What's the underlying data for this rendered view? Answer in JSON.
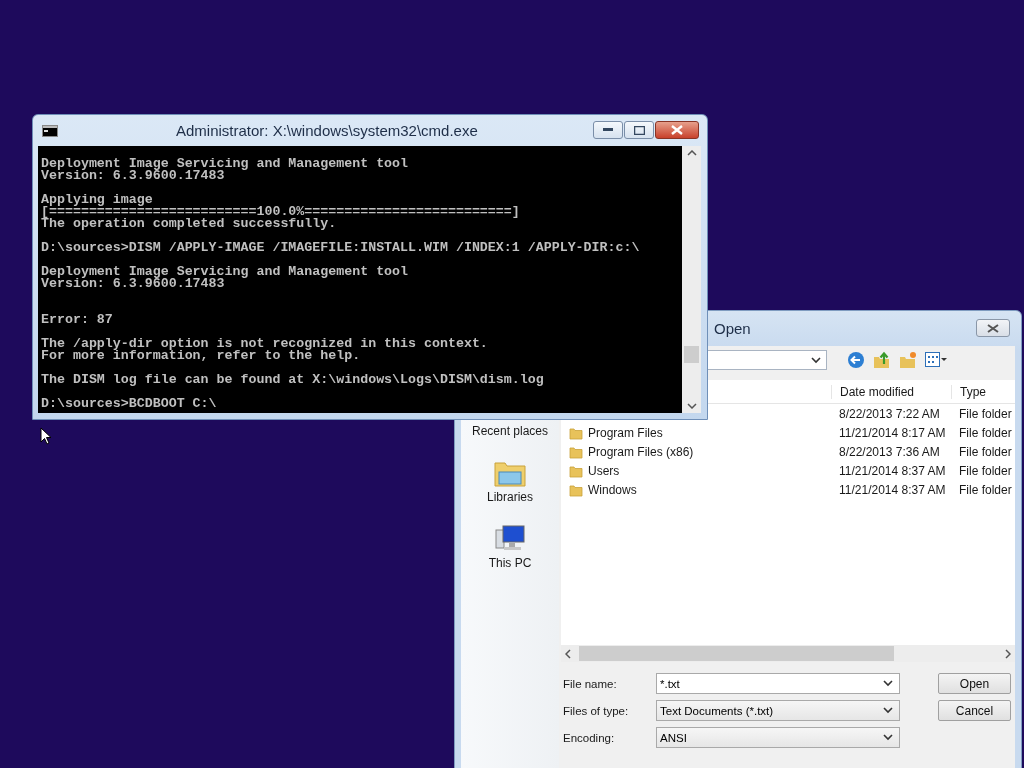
{
  "cmd_window": {
    "title": "Administrator: X:\\windows\\system32\\cmd.exe",
    "lines": [
      {
        "kind": "text",
        "text": "Deployment Image Servicing and Management tool"
      },
      {
        "kind": "text",
        "text": "Version: 6.3.9600.17483"
      },
      {
        "kind": "blank"
      },
      {
        "kind": "text",
        "text": "Applying image"
      },
      {
        "kind": "text",
        "text": "[==========================100.0%==========================]"
      },
      {
        "kind": "text",
        "text": "The operation completed successfully."
      },
      {
        "kind": "blank"
      },
      {
        "kind": "text",
        "text": "D:\\sources>DISM /APPLY-IMAGE /IMAGEFILE:INSTALL.WIM /INDEX:1 /APPLY-DIR:c:\\"
      },
      {
        "kind": "blank"
      },
      {
        "kind": "text",
        "text": "Deployment Image Servicing and Management tool"
      },
      {
        "kind": "text",
        "text": "Version: 6.3.9600.17483"
      },
      {
        "kind": "blank"
      },
      {
        "kind": "blank"
      },
      {
        "kind": "text",
        "text": "Error: 87"
      },
      {
        "kind": "blank"
      },
      {
        "kind": "text",
        "text": "The /apply-dir option is not recognized in this context."
      },
      {
        "kind": "text",
        "text": "For more information, refer to the help."
      },
      {
        "kind": "blank"
      },
      {
        "kind": "text",
        "text": "The DISM log file can be found at X:\\windows\\Logs\\DISM\\dism.log"
      },
      {
        "kind": "blank"
      },
      {
        "kind": "text",
        "text": "D:\\sources>BCDBOOT C:\\"
      }
    ]
  },
  "open_dialog": {
    "title": "Open",
    "nav_items": [
      {
        "kind": "recent",
        "label": "Recent places"
      },
      {
        "kind": "libraries",
        "label": "Libraries"
      },
      {
        "kind": "pc",
        "label": "This PC"
      }
    ],
    "columns": [
      "Date modified",
      "Type"
    ],
    "rows": [
      {
        "date": "8/22/2013 7:22 AM",
        "type": "File folder"
      },
      {
        "name": "Program Files",
        "date": "11/21/2014 8:17 AM",
        "type": "File folder"
      },
      {
        "name": "Program Files (x86)",
        "date": "8/22/2013 7:36 AM",
        "type": "File folder"
      },
      {
        "name": "Users",
        "date": "11/21/2014 8:37 AM",
        "type": "File folder"
      },
      {
        "name": "Windows",
        "date": "11/21/2014 8:37 AM",
        "type": "File folder"
      }
    ],
    "fields": [
      {
        "kind": "input",
        "label": "File name:",
        "value": "*.txt"
      },
      {
        "kind": "combo",
        "label": "Files of type:",
        "value": "Text Documents (*.txt)"
      },
      {
        "kind": "combo",
        "label": "Encoding:",
        "value": "ANSI"
      }
    ],
    "buttons": [
      "Open",
      "Cancel"
    ]
  }
}
